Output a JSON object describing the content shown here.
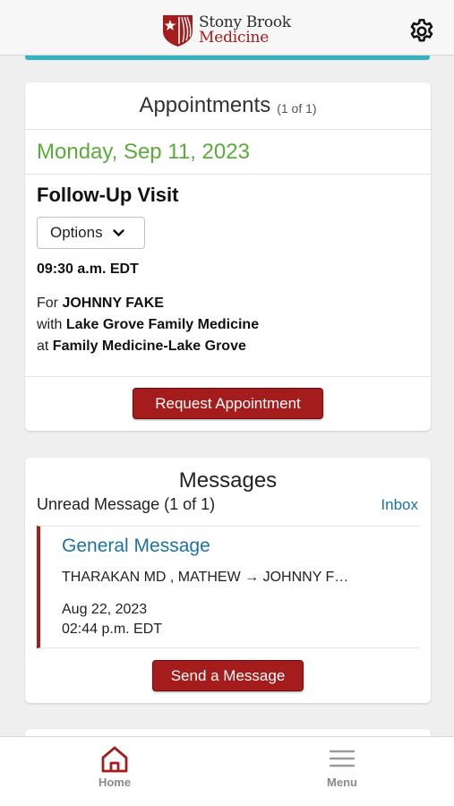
{
  "header": {
    "brand_line1": "Stony Brook",
    "brand_line2": "Medicine",
    "icons": {
      "logo": "stony-brook-shield",
      "settings": "gear-icon"
    },
    "accent_color": "#33b3c2"
  },
  "appointments": {
    "title": "Appointments",
    "count": "(1 of 1)",
    "date": "Monday, Sep 11, 2023",
    "visit_type": "Follow-Up Visit",
    "options_label": "Options",
    "time": "09:30 a.m. EDT",
    "for_prefix": "For",
    "patient": "JOHNNY FAKE",
    "with_prefix": "with",
    "provider": "Lake Grove Family Medicine",
    "at_prefix": "at",
    "location": "Family Medicine-Lake Grove",
    "request_button": "Request Appointment",
    "date_color": "#5cac3c"
  },
  "messages": {
    "title": "Messages",
    "unread": "Unread Message (1 of 1)",
    "inbox_link": "Inbox",
    "items": [
      {
        "type": "General Message",
        "from_to": "THARAKAN MD , MATHEW → JOHNNY F…",
        "date": "Aug 22, 2023",
        "time": "02:44 p.m. EDT"
      }
    ],
    "send_button": "Send a Message",
    "brand_red": "#a51c1c"
  },
  "bottom_nav": {
    "items": [
      {
        "label": "Home",
        "icon": "home-icon",
        "active": true
      },
      {
        "label": "Menu",
        "icon": "hamburger-menu-icon",
        "active": false
      }
    ]
  }
}
